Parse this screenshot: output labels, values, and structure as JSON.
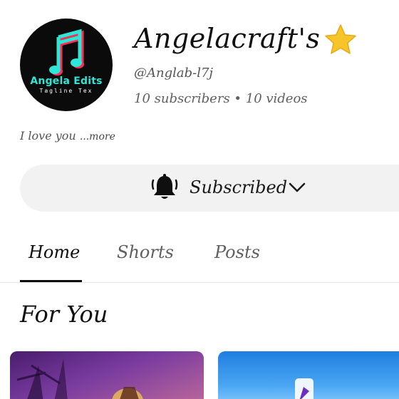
{
  "channel": {
    "name": "Angelacraft's",
    "handle": "@Anglab-l7j",
    "stats": "10 subscribers • 10 videos",
    "description": "I love you",
    "more_label": "...more",
    "avatar": {
      "brand_text": "Angela Edits",
      "tagline_text": "Tagline Tex"
    }
  },
  "subscribe": {
    "label": "Subscribed",
    "icon": "bell-icon"
  },
  "tabs": [
    {
      "label": "Home",
      "selected": true
    },
    {
      "label": "Shorts",
      "selected": false
    },
    {
      "label": "Posts",
      "selected": false
    }
  ],
  "section": {
    "title": "For You"
  },
  "colors": {
    "accent_teal": "#2ee6d6",
    "accent_pink": "#ff2d55",
    "star": "#f7c52b"
  }
}
